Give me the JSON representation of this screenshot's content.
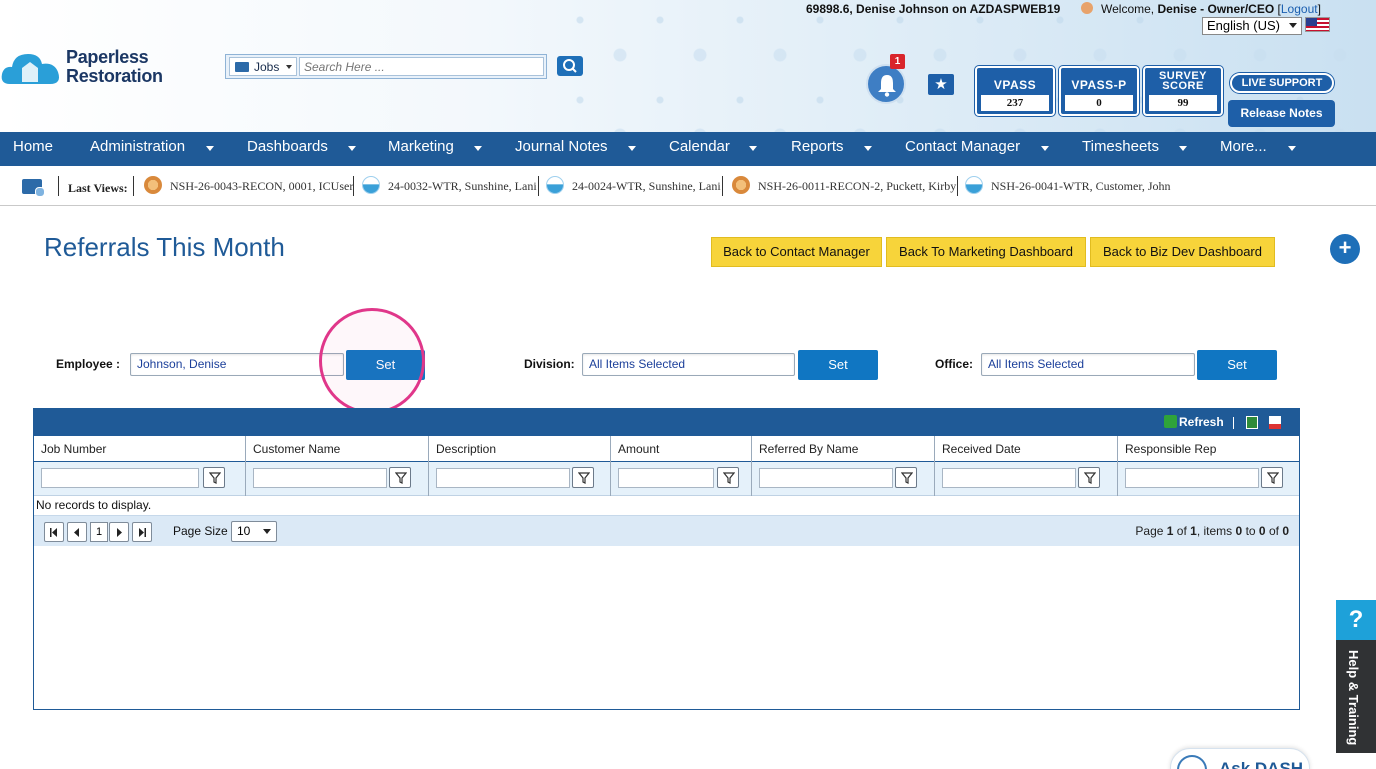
{
  "header": {
    "session_info": "69898.6, Denise Johnson on AZDASPWEB19",
    "welcome_prefix": "Welcome,",
    "welcome_user": "Denise - Owner/CEO",
    "logout_open": "[",
    "logout_label": "Logout",
    "logout_close": "]",
    "language": "English (US)",
    "logo_line1": "Paperless",
    "logo_line2": "Restoration",
    "search_type": "Jobs",
    "search_placeholder": "Search Here ...",
    "notification_count": "1",
    "scores": [
      {
        "label": "VPASS",
        "value": "237"
      },
      {
        "label": "VPASS-P",
        "value": "0"
      },
      {
        "label": "SURVEY SCORE",
        "value": "99"
      }
    ],
    "live_support": "LIVE SUPPORT",
    "release_notes": "Release Notes"
  },
  "nav": {
    "items": [
      "Home",
      "Administration",
      "Dashboards",
      "Marketing",
      "Journal Notes",
      "Calendar",
      "Reports",
      "Contact Manager",
      "Timesheets",
      "More..."
    ]
  },
  "last_views": {
    "label": "Last Views:",
    "items": [
      {
        "text": "NSH-26-0043-RECON, 0001, ICUser",
        "icon": "recon-icon"
      },
      {
        "text": "24-0032-WTR, Sunshine, Lani",
        "icon": "water-icon"
      },
      {
        "text": "24-0024-WTR, Sunshine, Lani",
        "icon": "water-icon"
      },
      {
        "text": "NSH-26-0011-RECON-2, Puckett, Kirby",
        "icon": "recon-icon"
      },
      {
        "text": "NSH-26-0041-WTR, Customer, John",
        "icon": "water-icon"
      }
    ]
  },
  "page": {
    "title": "Referrals This Month",
    "buttons": {
      "back_contact": "Back to Contact Manager",
      "back_marketing": "Back To Marketing Dashboard",
      "back_bizdev": "Back to Biz Dev Dashboard"
    },
    "add_symbol": "+"
  },
  "filters": {
    "employee_label": "Employee :",
    "employee_value": "Johnson, Denise",
    "division_label": "Division:",
    "division_value": "All Items Selected",
    "office_label": "Office:",
    "office_value": "All Items Selected",
    "set_label": "Set"
  },
  "grid": {
    "refresh_label": "Refresh",
    "columns": [
      "Job Number",
      "Customer Name",
      "Description",
      "Amount",
      "Referred By Name",
      "Received Date",
      "Responsible Rep"
    ],
    "no_records": "No records to display.",
    "current_page": "1",
    "page_size_label": "Page Size",
    "page_size": "10",
    "pager_info": {
      "prefix": "Page",
      "page": "1",
      "of": "of",
      "total_pages": "1",
      "items_prefix": ", items",
      "from": "0",
      "to_word": "to",
      "to": "0",
      "of2": "of",
      "total": "0"
    }
  },
  "side": {
    "help_symbol": "?",
    "help_label": "Help & Training",
    "ask_dash": "Ask DASH"
  },
  "colors": {
    "brand_blue": "#1f5a97",
    "button_yellow": "#f7d43a",
    "set_blue": "#1076c2",
    "highlight": "#e0378a"
  }
}
